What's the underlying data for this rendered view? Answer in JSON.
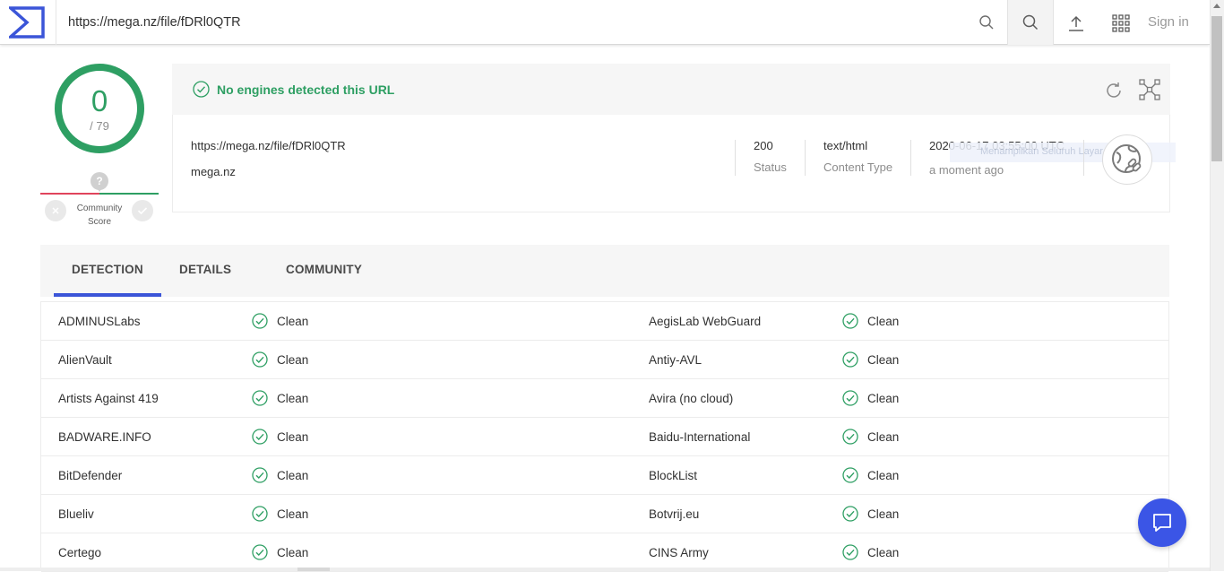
{
  "topbar": {
    "url_value": "https://mega.nz/file/fDRl0QTR",
    "signin_label": "Sign in"
  },
  "score": {
    "detections": "0",
    "total": "/ 79",
    "community_label": "Community Score",
    "community_icon": "?"
  },
  "summary": {
    "status_message": "No engines detected this URL",
    "url": "https://mega.nz/file/fDRl0QTR",
    "domain": "mega.nz",
    "status_value": "200",
    "status_label": "Status",
    "content_type_value": "text/html",
    "content_type_label": "Content Type",
    "date_value": "2020-06-17 03:55:00 UTC",
    "date_label": "a moment ago",
    "ghost_tooltip": "Menampilkan Seluruh Layar"
  },
  "tabs": {
    "detection": "DETECTION",
    "details": "DETAILS",
    "community": "COMMUNITY"
  },
  "results": [
    {
      "left": "ADMINUSLabs",
      "left_result": "Clean",
      "right": "AegisLab WebGuard",
      "right_result": "Clean"
    },
    {
      "left": "AlienVault",
      "left_result": "Clean",
      "right": "Antiy-AVL",
      "right_result": "Clean"
    },
    {
      "left": "Artists Against 419",
      "left_result": "Clean",
      "right": "Avira (no cloud)",
      "right_result": "Clean"
    },
    {
      "left": "BADWARE.INFO",
      "left_result": "Clean",
      "right": "Baidu-International",
      "right_result": "Clean"
    },
    {
      "left": "BitDefender",
      "left_result": "Clean",
      "right": "BlockList",
      "right_result": "Clean"
    },
    {
      "left": "Blueliv",
      "left_result": "Clean",
      "right": "Botvrij.eu",
      "right_result": "Clean"
    },
    {
      "left": "Certego",
      "left_result": "Clean",
      "right": "CINS Army",
      "right_result": "Clean"
    }
  ],
  "colors": {
    "clean_green": "#2e9f63",
    "accent_blue": "#3b55d8",
    "chat_blue": "#3b55e6",
    "malicious_red": "#e0445c"
  },
  "icons": {
    "logo": "virustotal-sigma-logo",
    "search": "search-icon",
    "upload": "upload-icon",
    "apps": "apps-grid-icon",
    "reload": "reload-icon",
    "graph": "graph-icon",
    "globe": "globe-link-icon",
    "check": "check-circle-icon",
    "chat": "chat-icon"
  }
}
